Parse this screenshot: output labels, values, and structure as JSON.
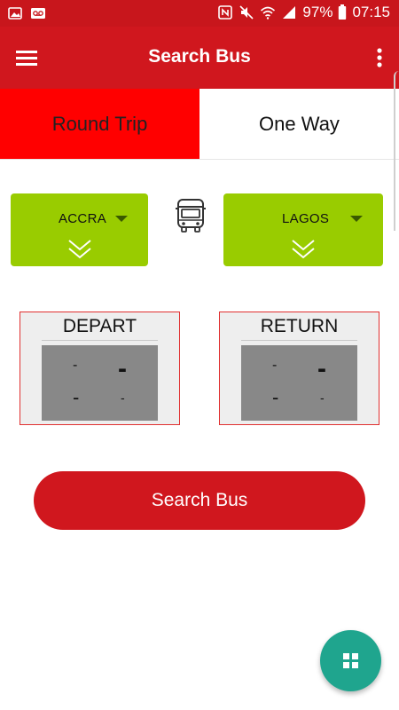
{
  "status_bar": {
    "battery": "97%",
    "time": "07:15",
    "left_icons": [
      "image-icon",
      "voicemail-icon"
    ],
    "right_icons": [
      "nfc-icon",
      "mute-icon",
      "wifi-icon",
      "signal-icon",
      "battery-icon"
    ]
  },
  "app_bar": {
    "title": "Search Bus",
    "menu_icon": "hamburger-menu-icon",
    "overflow_icon": "more-vert-icon"
  },
  "trip_tabs": [
    {
      "label": "Round Trip",
      "active": true
    },
    {
      "label": "One Way",
      "active": false
    }
  ],
  "route": {
    "from": {
      "city": "ACCRA"
    },
    "to": {
      "city": "LAGOS"
    },
    "separator_icon": "bus-icon"
  },
  "dates": {
    "depart": {
      "label": "DEPART",
      "day": "-",
      "date": "-",
      "month": "-",
      "year": "-"
    },
    "return": {
      "label": "RETURN",
      "day": "-",
      "date": "-",
      "month": "-",
      "year": "-"
    }
  },
  "search_button": {
    "label": "Search Bus"
  },
  "fab": {
    "icon": "grid-icon"
  },
  "colors": {
    "primary": "#d0171e",
    "status_bar": "#c8161c",
    "active_tab": "#ff0000",
    "city_box": "#99cc00",
    "date_panel": "#888888",
    "fab": "#1fa58e"
  }
}
